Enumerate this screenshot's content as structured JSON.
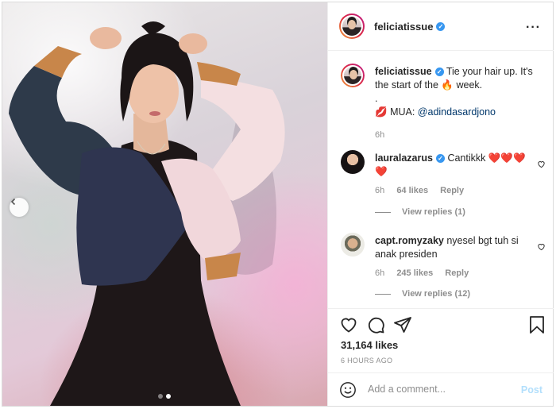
{
  "post": {
    "username": "feliciatissue",
    "more_icon": "ellipsis-icon"
  },
  "caption": {
    "username": "feliciatissue",
    "text_before": "Tie your hair up. It's the start of the",
    "emoji_fire": "🔥",
    "text_after": "week.",
    "dot_line": ".",
    "lips_emoji": "💋",
    "mua_label": "MUA:",
    "mua_handle": "@adindasardjono",
    "time": "6h"
  },
  "comments": [
    {
      "username": "lauralazarus",
      "verified": true,
      "text": "Cantikkk ❤️❤️❤️ ❤️",
      "time": "6h",
      "likes": "64 likes",
      "reply": "Reply",
      "view_replies": "View replies (1)"
    },
    {
      "username": "capt.romyzaky",
      "verified": false,
      "text": "nyesel bgt tuh si anak presiden",
      "time": "6h",
      "likes": "245 likes",
      "reply": "Reply",
      "view_replies": "View replies (12)"
    }
  ],
  "stats": {
    "likes": "31,164 likes",
    "posted": "6 HOURS AGO"
  },
  "composer": {
    "placeholder": "Add a comment...",
    "post_label": "Post"
  },
  "carousel": {
    "slide_count": 2,
    "active_index": 1
  },
  "colors": {
    "verified": "#3897f0",
    "link": "#00376b",
    "post_disabled": "#b2dffc"
  }
}
